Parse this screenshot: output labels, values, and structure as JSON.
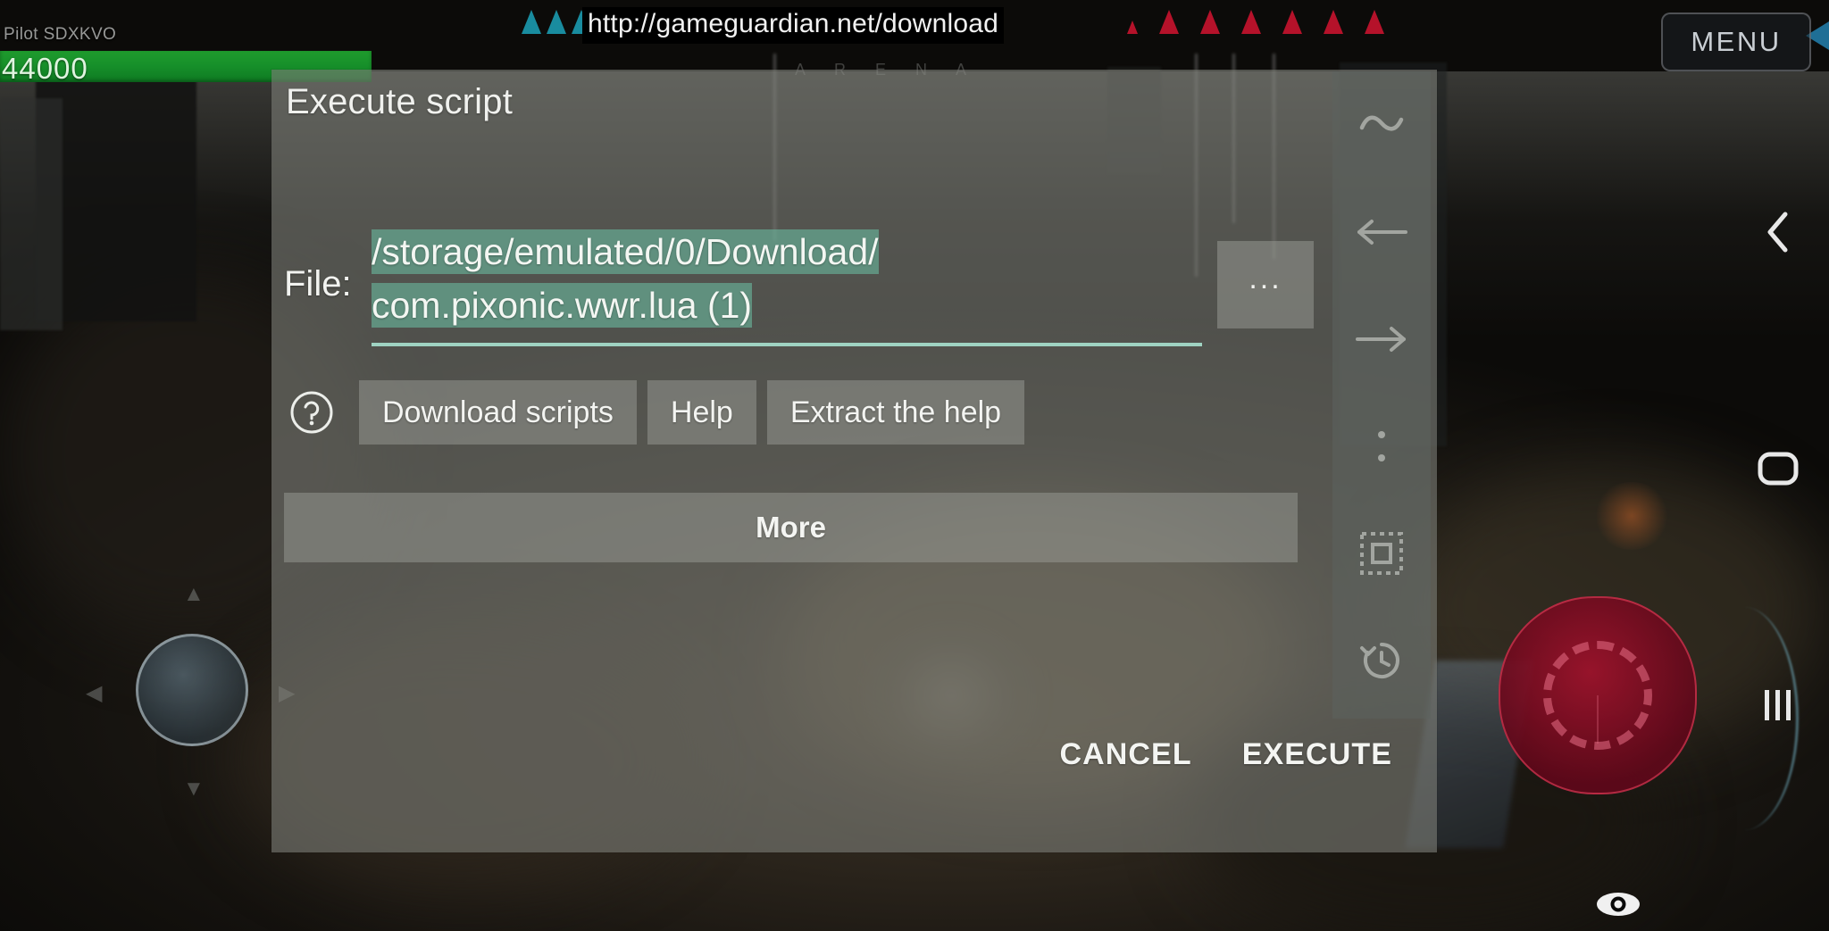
{
  "game_hud": {
    "pilot_label": "Pilot SDXKVO",
    "health_value": "44000",
    "arena_label": "A R E N A",
    "menu_label": "MENU",
    "ally_marker_count": 3,
    "enemy_marker_count": 7,
    "colors": {
      "health_bar": "#17902a",
      "ally_marker": "#1a93a8",
      "enemy_marker": "#b5122a",
      "fire_button": "#a0122c",
      "menu_flag": "#1f6f96"
    },
    "joystick_icon": "virtual-joystick",
    "fire_icon": "crosshair-reticle"
  },
  "url_overlay": {
    "text": "http://gameguardian.net/download"
  },
  "dialog": {
    "title": "Execute script",
    "file_label": "File:",
    "file_value_line1": "/storage/emulated/0/Download/",
    "file_value_line2": "com.pixonic.wwr.lua (1)",
    "file_value_full": "/storage/emulated/0/Download/com.pixonic.wwr.lua (1)",
    "browse_label": "...",
    "help_icon": "question-mark-circle-icon",
    "buttons": [
      {
        "label": "Download scripts",
        "name": "download-scripts-button"
      },
      {
        "label": "Help",
        "name": "help-button"
      },
      {
        "label": "Extract the help",
        "name": "extract-the-help-button"
      }
    ],
    "more_label": "More",
    "cancel_label": "CANCEL",
    "execute_label": "EXECUTE",
    "selection_color": "#69b69c",
    "underline_color": "#9fd3c2"
  },
  "gg_toolbar": {
    "items": [
      {
        "name": "tilde-icon",
        "glyph": "~"
      },
      {
        "name": "arrow-left-icon",
        "glyph": "←"
      },
      {
        "name": "arrow-right-icon",
        "glyph": "→"
      },
      {
        "name": "vertical-dots-icon",
        "glyph": "⋮"
      },
      {
        "name": "select-area-icon",
        "glyph": "▣"
      },
      {
        "name": "history-icon",
        "glyph": "⟲"
      }
    ]
  },
  "android_nav": {
    "back_label": "‹",
    "home_label": "▢",
    "recents_label": "|||",
    "eye_icon": "eye-icon"
  }
}
